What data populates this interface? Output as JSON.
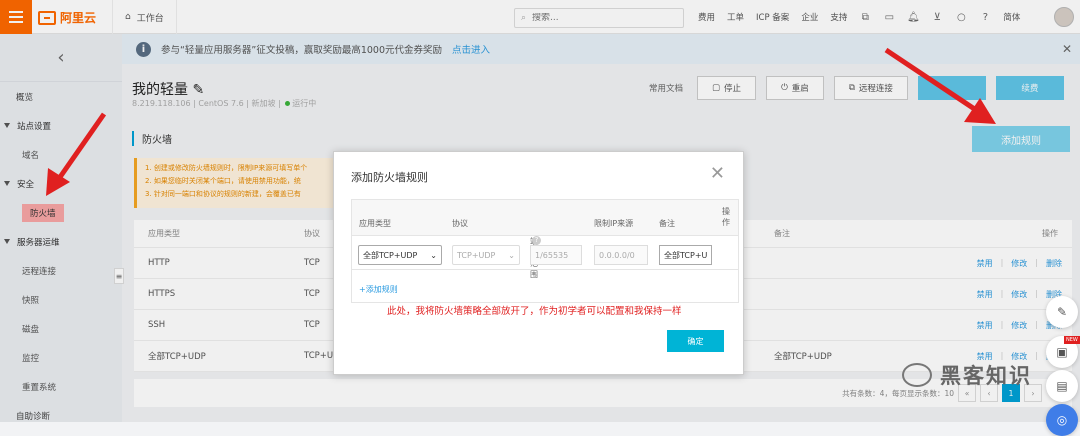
{
  "topbar": {
    "logo_text": "阿里云",
    "workbench": "工作台",
    "search_placeholder": "搜索...",
    "nav": [
      "费用",
      "工单",
      "ICP 备案",
      "企业",
      "支持"
    ],
    "lang": "简体"
  },
  "sidebar": {
    "items": [
      {
        "type": "item",
        "label": "概览"
      },
      {
        "type": "group",
        "label": "站点设置"
      },
      {
        "type": "sub",
        "label": "域名"
      },
      {
        "type": "group",
        "label": "安全"
      },
      {
        "type": "sub-active",
        "label": "防火墙"
      },
      {
        "type": "group",
        "label": "服务器运维"
      },
      {
        "type": "sub",
        "label": "远程连接"
      },
      {
        "type": "sub",
        "label": "快照"
      },
      {
        "type": "sub",
        "label": "磁盘"
      },
      {
        "type": "sub",
        "label": "监控"
      },
      {
        "type": "sub",
        "label": "重置系统"
      },
      {
        "type": "item",
        "label": "自助诊断"
      }
    ]
  },
  "banner": {
    "text": "参与“轻量应用服务器”征文投稿，赢取奖励最高1000元代金券奖励",
    "link": "点击进入"
  },
  "header": {
    "title": "我的轻量",
    "subtitle_ip": "8.219.118.106",
    "subtitle_os": "CentOS 7.6",
    "subtitle_region": "新加坡",
    "subtitle_status": "运行中",
    "doc": "常用文档",
    "stop": "停止",
    "restart": "重启",
    "remote": "远程连接",
    "renew": "续费"
  },
  "firewall": {
    "section_title": "防火墙",
    "add_rule": "添加规则",
    "notice": [
      "1. 创建或修改防火墙规则时，限制IP来源可填写单个",
      "2. 如果您临时关闭某个端口，请使用禁用功能，统",
      "3. 针对同一端口和协议的规则的新建，会覆盖已有"
    ],
    "columns": {
      "type": "应用类型",
      "protocol": "协议",
      "remark": "备注",
      "ops": "操作"
    },
    "rows": [
      {
        "type": "HTTP",
        "protocol": "TCP",
        "remark": ""
      },
      {
        "type": "HTTPS",
        "protocol": "TCP",
        "remark": ""
      },
      {
        "type": "SSH",
        "protocol": "TCP",
        "remark": ""
      },
      {
        "type": "全部TCP+UDP",
        "protocol": "TCP+U",
        "remark": "全部TCP+UDP"
      }
    ],
    "op_disable": "禁用",
    "op_edit": "修改",
    "op_delete": "删除",
    "pager_text": "共有条数：4，每页显示条数：10",
    "page_current": "1"
  },
  "modal": {
    "title": "添加防火墙规则",
    "columns": {
      "type": "应用类型",
      "protocol": "协议",
      "port": "端口范围",
      "ip": "限制IP来源",
      "remark": "备注",
      "ops": "操作"
    },
    "row": {
      "type_value": "全部TCP+UDP",
      "protocol_value": "TCP+UDP",
      "port_value": "1/65535",
      "ip_value": "0.0.0.0/0",
      "remark_value": "全部TCP+U"
    },
    "add_link": "+添加规则",
    "note": "此处，我将防火墙策略全部放开了，作为初学者可以配置和我保持一样",
    "confirm": "确定"
  },
  "watermark": {
    "text": "黑客知识"
  },
  "floating": {
    "new_badge": "NEW"
  },
  "colors": {
    "brand": "#ff6a00",
    "accent": "#00a1d6",
    "annotation": "#e02020"
  }
}
